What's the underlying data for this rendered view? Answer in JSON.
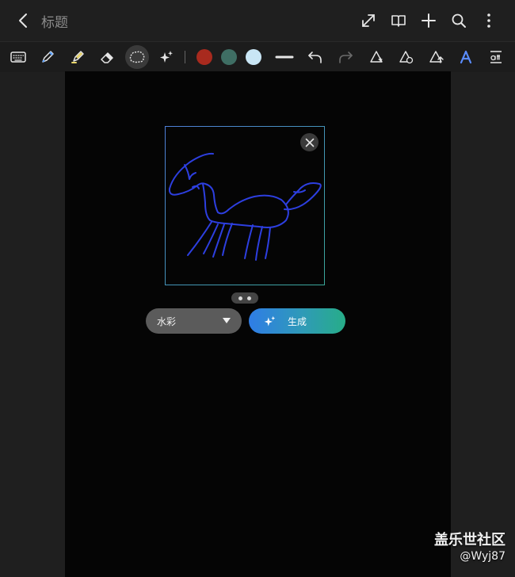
{
  "header": {
    "title": "标题",
    "actions": [
      "expand-icon",
      "book-icon",
      "add-icon",
      "search-icon",
      "more-icon"
    ]
  },
  "toolbar": {
    "tools": [
      "keyboard-icon",
      "pen-icon",
      "highlighter-icon",
      "eraser-icon",
      "lasso-icon",
      "ai-sparkle-icon"
    ],
    "active_tool": "lasso-icon",
    "colors": [
      "#a82a1e",
      "#3f6e64",
      "#c9e6f5"
    ],
    "right_tools": [
      "stroke-width-icon",
      "undo-icon",
      "redo-icon",
      "shape-effect-icon",
      "shape-refresh-icon",
      "shape-upload-icon",
      "text-style-icon",
      "text-format-icon"
    ]
  },
  "generator": {
    "style_label": "水彩",
    "generate_label": "生成",
    "sketch_color": "#2d3fe0"
  },
  "watermark": {
    "site": "盖乐世社区",
    "user": "@Wyj87"
  }
}
